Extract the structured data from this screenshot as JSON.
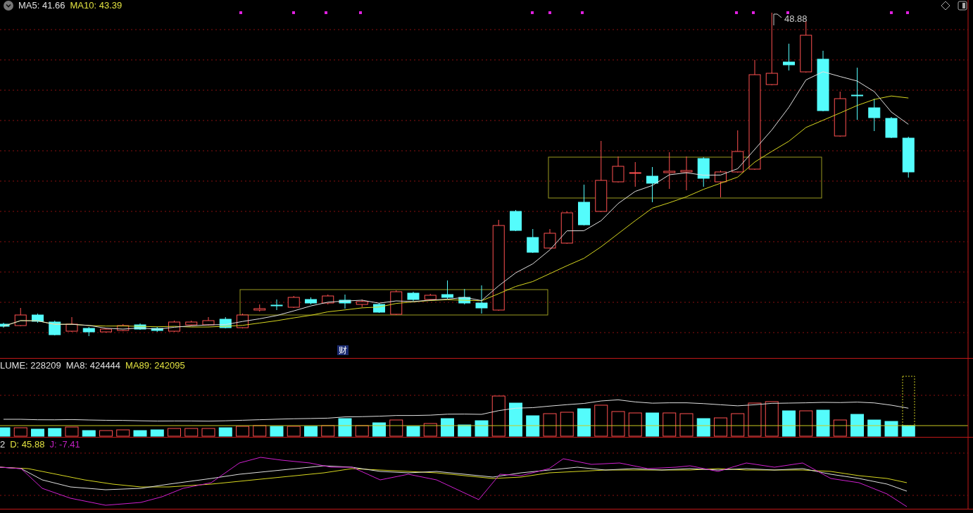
{
  "price_panel": {
    "legend": [
      {
        "label": "MA5: 41.66",
        "color": "#e0e0e0"
      },
      {
        "label": "MA10: 43.39",
        "color": "#e0e040"
      }
    ],
    "peak_label": "48.88",
    "event_marker": "财"
  },
  "volume_panel": {
    "legend": [
      {
        "label": "LUME: 228209",
        "color": "#e0e0e0"
      },
      {
        "label": "MA8: 424444",
        "color": "#e0e0e0"
      },
      {
        "label": "MA89: 242095",
        "color": "#e0e040"
      }
    ]
  },
  "kdj_panel": {
    "legend": [
      {
        "label": "2",
        "color": "#e0e0e0"
      },
      {
        "label": "D: 45.88",
        "color": "#e0e040"
      },
      {
        "label": "J: -7.41",
        "color": "#c020c0"
      }
    ]
  }
}
